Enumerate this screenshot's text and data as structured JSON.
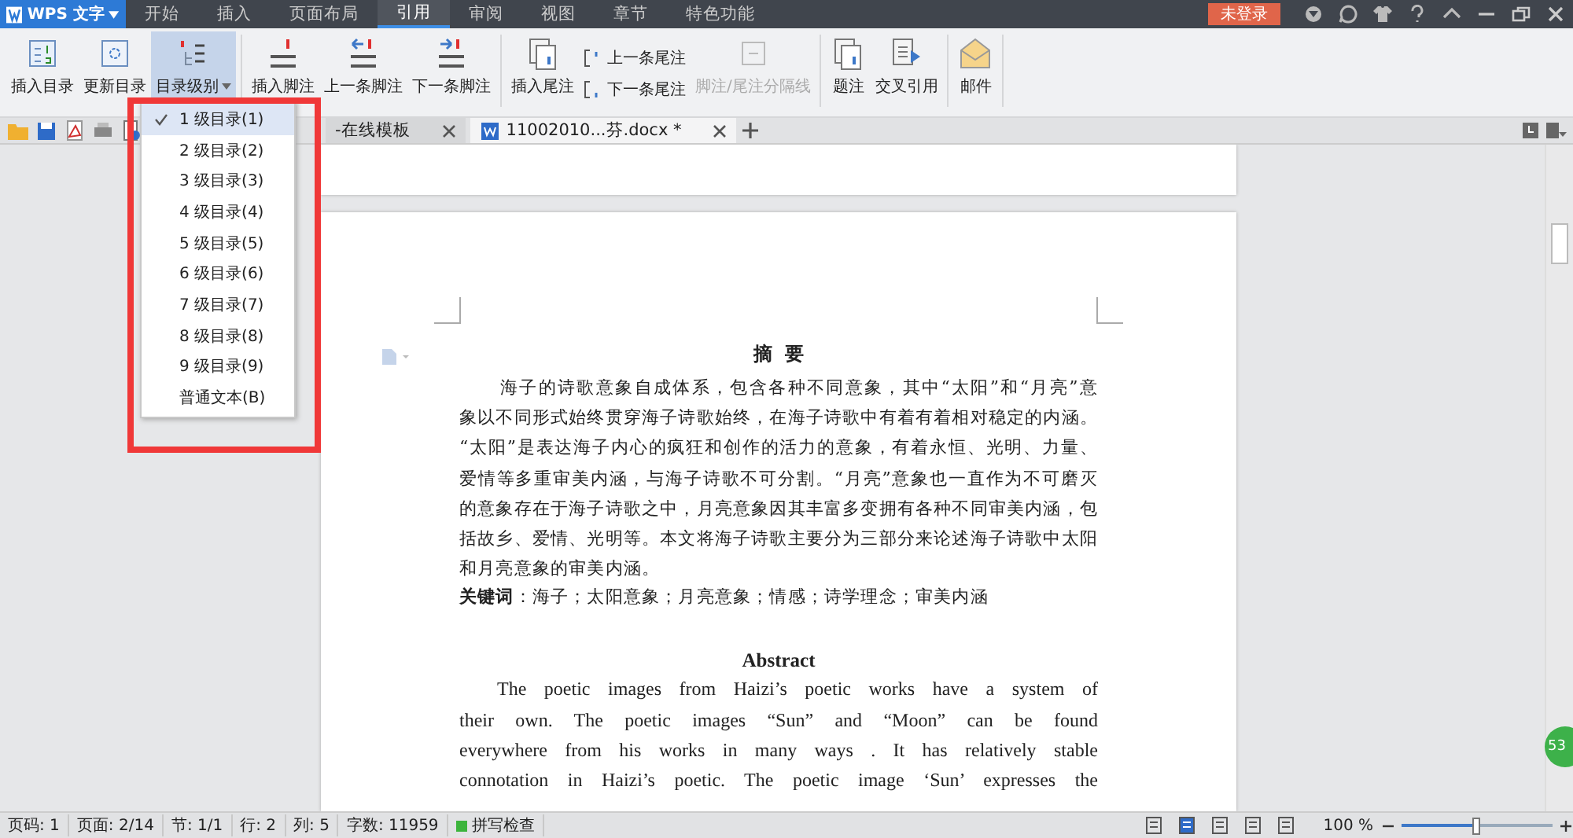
{
  "app_menu": {
    "title": "WPS 文字"
  },
  "menu_tabs": [
    {
      "label": "开始",
      "selected": false
    },
    {
      "label": "插入",
      "selected": false
    },
    {
      "label": "页面布局",
      "selected": false
    },
    {
      "label": "引用",
      "selected": true
    },
    {
      "label": "审阅",
      "selected": false
    },
    {
      "label": "视图",
      "selected": false
    },
    {
      "label": "章节",
      "selected": false
    },
    {
      "label": "特色功能",
      "selected": false
    }
  ],
  "login_button": "未登录",
  "ribbon": [
    {
      "kind": "large",
      "label": "插入目录",
      "selected": false,
      "disabled": false
    },
    {
      "kind": "large",
      "label": "更新目录",
      "selected": false,
      "disabled": false
    },
    {
      "kind": "large",
      "label": "目录级别",
      "selected": true,
      "disabled": false,
      "dropdown": true
    },
    {
      "kind": "large",
      "label": "插入脚注",
      "selected": false,
      "disabled": false
    },
    {
      "kind": "large",
      "label": "上一条脚注",
      "selected": false,
      "disabled": false
    },
    {
      "kind": "large",
      "label": "下一条脚注",
      "selected": false,
      "disabled": false
    },
    {
      "kind": "large",
      "label": "插入尾注",
      "selected": false,
      "disabled": false
    },
    {
      "kind": "stack",
      "items": [
        {
          "label": "上一条尾注"
        },
        {
          "label": "下一条尾注"
        }
      ]
    },
    {
      "kind": "large",
      "label": "脚注/尾注分隔线",
      "selected": false,
      "disabled": true
    },
    {
      "kind": "large",
      "label": "题注",
      "selected": false,
      "disabled": false
    },
    {
      "kind": "large",
      "label": "交叉引用",
      "selected": false,
      "disabled": false
    },
    {
      "kind": "large",
      "label": "邮件",
      "selected": false,
      "disabled": false
    }
  ],
  "doc_tabs": [
    {
      "label": "-在线模板",
      "selected": false
    },
    {
      "label": "11002010...芬.docx *",
      "selected": true
    }
  ],
  "level_menu": [
    {
      "label": "1 级目录(1)",
      "selected": true
    },
    {
      "label": "2 级目录(2)",
      "selected": false
    },
    {
      "label": "3 级目录(3)",
      "selected": false
    },
    {
      "label": "4 级目录(4)",
      "selected": false
    },
    {
      "label": "5 级目录(5)",
      "selected": false
    },
    {
      "label": "6 级目录(6)",
      "selected": false
    },
    {
      "label": "7 级目录(7)",
      "selected": false
    },
    {
      "label": "8 级目录(8)",
      "selected": false
    },
    {
      "label": "9 级目录(9)",
      "selected": false
    },
    {
      "label": "普通文本(B)",
      "selected": false
    }
  ],
  "document": {
    "cn_heading": "摘  要",
    "cn_lines": [
      "海子的诗歌意象自成体系，包含各种不同意象，其中“太阳”和“月亮”意",
      "象以不同形式始终贯穿海子诗歌始终，在海子诗歌中有着有着相对稳定的内涵。",
      "“太阳”是表达海子内心的疯狂和创作的活力的意象，有着永恒、光明、力量、",
      "爱情等多重审美内涵，与海子诗歌不可分割。“月亮”意象也一直作为不可磨灭",
      "的意象存在于海子诗歌之中，月亮意象因其丰富多变拥有各种不同审美内涵，包",
      "括故乡、爱情、光明等。本文将海子诗歌主要分为三部分来论述海子诗歌中太阳",
      "和月亮意象的审美内涵。"
    ],
    "keywords": "**关键词**：海子；太阳意象；月亮意象；情感；诗学理念；审美内涵",
    "en_heading": "Abstract",
    "en_lines": [
      "The poetic images from Haizi’s poetic works have a system of",
      "their own. The poetic images “Sun” and “Moon” can be found",
      "everywhere from his works in many ways . It has relatively stable",
      "connotation in Haizi’s poetic. The poetic image ‘Sun’ expresses the"
    ]
  },
  "side_badge": "53",
  "status_bar": {
    "items": [
      "页码: 1",
      "页面: 2/14",
      "节: 1/1",
      "行: 2",
      "列: 5",
      "字数: 11959"
    ],
    "spell_check": "拼写检查",
    "zoom": "100 %",
    "zoom_slider": {
      "level": 0.5
    }
  }
}
